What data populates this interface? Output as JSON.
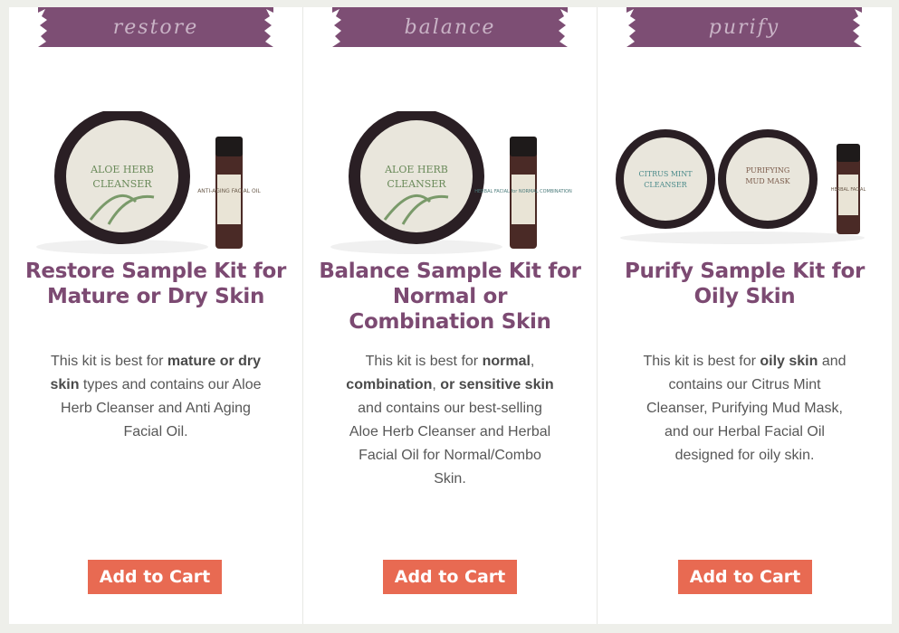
{
  "products": [
    {
      "banner": "restore",
      "title": "Restore Sample Kit for Mature or Dry Skin",
      "desc_parts": [
        "This kit is best for ",
        "mature or dry skin",
        " types and contains our Aloe Herb Cleanser and Anti Aging Facial Oil."
      ],
      "jar_labels": [
        "ALOE HERB",
        "CLEANSER"
      ],
      "vial_label": "ANTI-AGING FACIAL OIL",
      "cta": "Add to Cart"
    },
    {
      "banner": "balance",
      "title": "Balance Sample Kit for Normal or Combination Skin",
      "desc_parts": [
        "This kit is best for ",
        "normal",
        ", ",
        "combination",
        ", ",
        "or sensitive skin",
        " and contains our best-selling Aloe Herb Cleanser and Herbal Facial Oil for Normal/Combo Skin."
      ],
      "jar_labels": [
        "ALOE HERB",
        "CLEANSER"
      ],
      "vial_label": "HERBAL FACIAL for NORMAL COMBINATION",
      "cta": "Add to Cart"
    },
    {
      "banner": "purify",
      "title": "Purify Sample Kit for Oily Skin",
      "desc_parts": [
        "This kit is best for ",
        "oily skin",
        " and contains our Citrus Mint Cleanser, Purifying Mud Mask, and our Herbal Facial Oil designed for oily skin."
      ],
      "jar_labels": [
        "CITRUS MINT",
        "CLEANSER"
      ],
      "jar2_labels": [
        "PURIFYING",
        "MUD MASK"
      ],
      "vial_label": "HERBAL FACIAL",
      "cta": "Add to Cart"
    }
  ],
  "colors": {
    "brand_purple": "#7c4a72",
    "banner_purple": "#7d4e74",
    "cta": "#e86a52"
  }
}
